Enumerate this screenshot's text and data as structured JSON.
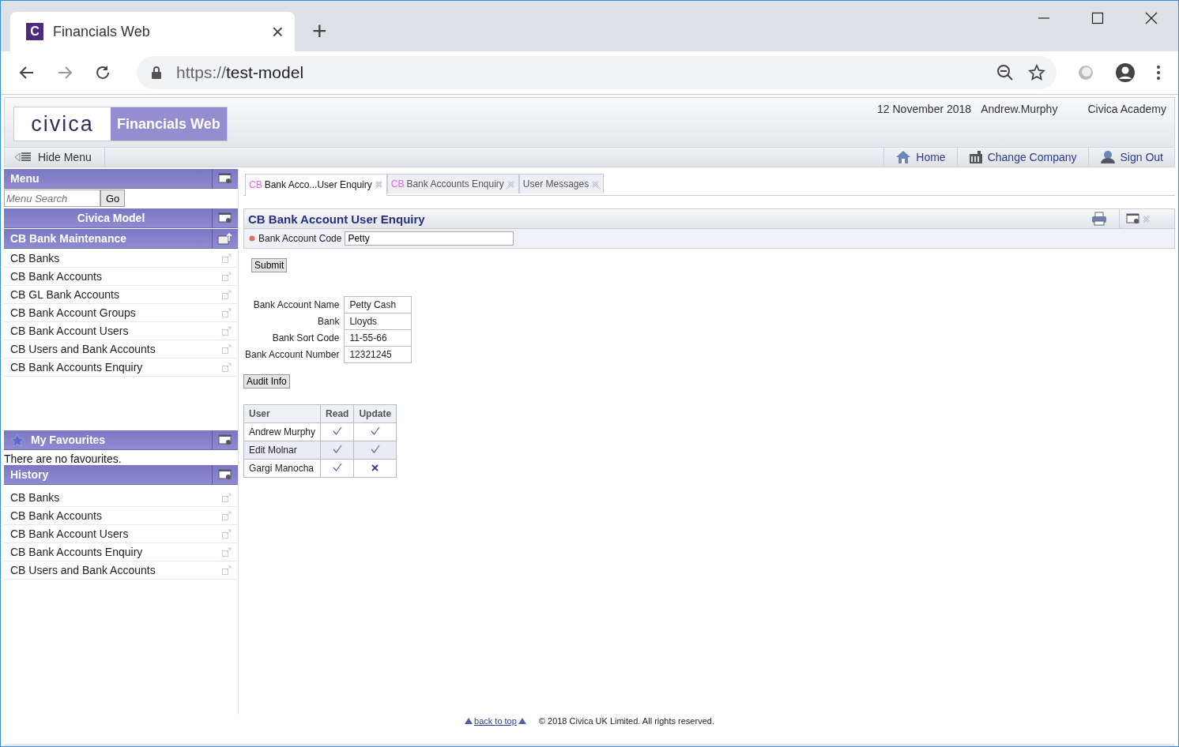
{
  "browser": {
    "tab": {
      "favicon": "C",
      "title": "Financials Web",
      "close": "×"
    },
    "new_tab": "+",
    "address": {
      "scheme": "https://",
      "host": "test-model"
    }
  },
  "header": {
    "logo": "civica",
    "product": "Financials Web",
    "date": "12 November 2018",
    "user": "Andrew.Murphy",
    "company": "Civica Academy"
  },
  "toolbar": {
    "hide_menu": "Hide Menu",
    "links": [
      {
        "kind": "home",
        "label": "Home"
      },
      {
        "kind": "company",
        "label": "Change Company"
      },
      {
        "kind": "signout",
        "label": "Sign Out"
      }
    ]
  },
  "sidebar": {
    "menu_title": "Menu",
    "search": {
      "placeholder": "Menu Search",
      "button": "Go"
    },
    "model_title": "Civica Model",
    "section_title": "CB Bank Maintenance",
    "items": [
      "CB Banks",
      "CB Bank Accounts",
      "CB GL Bank Accounts",
      "CB Bank Account Groups",
      "CB Bank Account Users",
      "CB Users and Bank Accounts",
      "CB Bank Accounts Enquiry"
    ],
    "favourites_title": "My Favourites",
    "favourites_empty": "There are no favourites.",
    "history_title": "History",
    "history": [
      "CB Banks",
      "CB Bank Accounts",
      "CB Bank Account Users",
      "CB Bank Accounts Enquiry",
      "CB Users and Bank Accounts"
    ]
  },
  "tabs": [
    {
      "prefix": "CB",
      "label": "Bank Acco...User Enquiry",
      "selected": true
    },
    {
      "prefix": "CB",
      "label": "Bank Accounts Enquiry",
      "selected": false
    },
    {
      "label": "User Messages",
      "selected": false
    }
  ],
  "panel": {
    "title": "CB Bank Account User Enquiry",
    "code_label": "Bank Account Code",
    "code_value": "Petty",
    "submit": "Submit",
    "details": [
      {
        "label": "Bank Account Name",
        "value": "Petty Cash"
      },
      {
        "label": "Bank",
        "value": "Lloyds"
      },
      {
        "label": "Bank Sort Code",
        "value": "11-55-66"
      },
      {
        "label": "Bank Account Number",
        "value": "12321245"
      }
    ],
    "audit": "Audit Info",
    "table": {
      "columns": [
        "User",
        "Read",
        "Update"
      ],
      "rows": [
        {
          "user": "Andrew Murphy",
          "read": true,
          "update": true
        },
        {
          "user": "Edit Molnar",
          "read": true,
          "update": true
        },
        {
          "user": "Gargi Manocha",
          "read": true,
          "update": false
        }
      ]
    }
  },
  "footer": {
    "back_to_top": "back to top",
    "copyright": "© 2018 Civica UK Limited. All rights reserved."
  }
}
